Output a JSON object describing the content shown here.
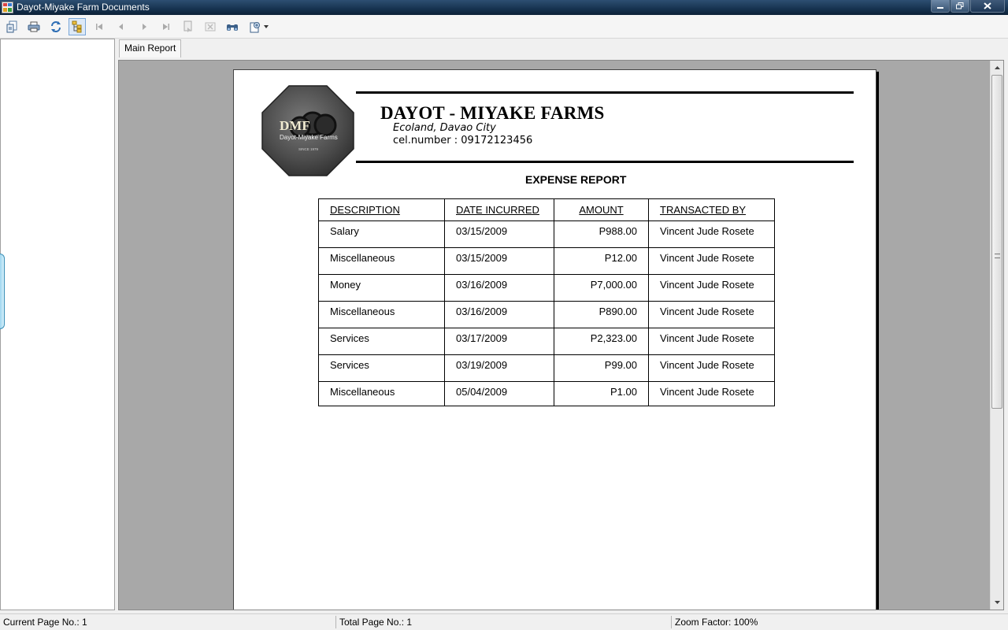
{
  "window": {
    "title": "Dayot-Miyake Farm Documents"
  },
  "toolbar": {
    "buttons": [
      "export-icon",
      "print-icon",
      "refresh-icon",
      "toggle-group-tree-icon",
      "first-page-icon",
      "previous-page-icon",
      "next-page-icon",
      "last-page-icon",
      "goto-page-icon",
      "close-view-icon",
      "find-icon",
      "zoom-icon"
    ]
  },
  "tabs": [
    {
      "label": "Main Report"
    }
  ],
  "report": {
    "logo": {
      "text": "DMF",
      "subtext": "Dayot-Miyake Farms",
      "tagline": "SINCE 1979"
    },
    "company": "DAYOT - MIYAKE FARMS",
    "address": "Ecoland, Davao City",
    "phone": "cel.number : 09172123456",
    "title": "EXPENSE REPORT",
    "columns": [
      "DESCRIPTION",
      "DATE INCURRED",
      "AMOUNT",
      "TRANSACTED BY"
    ],
    "rows": [
      [
        "Salary",
        "03/15/2009",
        "P988.00",
        "Vincent Jude Rosete"
      ],
      [
        "Miscellaneous",
        "03/15/2009",
        "P12.00",
        "Vincent Jude Rosete"
      ],
      [
        "Money",
        "03/16/2009",
        "P7,000.00",
        "Vincent Jude Rosete"
      ],
      [
        "Miscellaneous",
        "03/16/2009",
        "P890.00",
        "Vincent Jude Rosete"
      ],
      [
        "Services",
        "03/17/2009",
        "P2,323.00",
        "Vincent Jude Rosete"
      ],
      [
        "Services",
        "03/19/2009",
        "P99.00",
        "Vincent Jude Rosete"
      ],
      [
        "Miscellaneous",
        "05/04/2009",
        "P1.00",
        "Vincent Jude Rosete"
      ]
    ]
  },
  "status": {
    "current_page": "Current Page No.: 1",
    "total_page": "Total Page No.: 1",
    "zoom": "Zoom Factor: 100%"
  }
}
